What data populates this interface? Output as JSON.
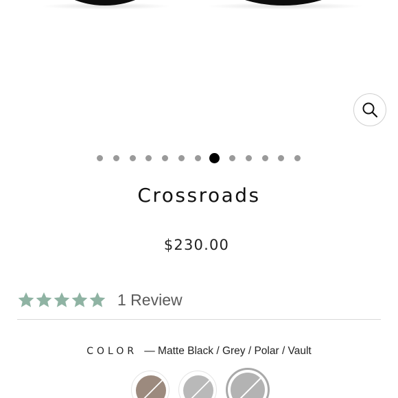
{
  "product": {
    "title": "Crossroads",
    "price": "$230.00"
  },
  "gallery": {
    "slide_count": 13,
    "active_index": 7
  },
  "reviews": {
    "rating": 5,
    "max_rating": 5,
    "count_label": "1 Review"
  },
  "color": {
    "label": "COLOR",
    "selected_value": "— Matte Black / Grey / Polar / Vault",
    "swatches": [
      {
        "name": "brown-swatch",
        "color": "#9c8a7e",
        "available": false
      },
      {
        "name": "grey-swatch",
        "color": "#b9b9b9",
        "available": false
      },
      {
        "name": "grey-swatch-selected",
        "color": "#b3b3b3",
        "available": false,
        "selected": true
      }
    ]
  },
  "colors": {
    "star": "#8fb3a3",
    "dot_inactive": "#9a9a9a",
    "dot_active": "#000000"
  },
  "icons": {
    "zoom": "search-icon",
    "star": "star-icon"
  }
}
